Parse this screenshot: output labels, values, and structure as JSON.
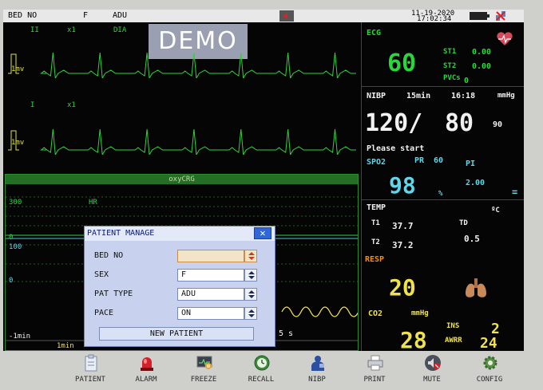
{
  "topbar": {
    "bed_label": "BED NO",
    "sex": "F",
    "pat_type": "ADU",
    "date": "11-19-2020",
    "time": "17:02:34"
  },
  "waves": {
    "lead1_name": "II",
    "lead1_gain": "x1",
    "lead1_filter": "DIA",
    "lead2_name": "I",
    "lead2_gain": "x1",
    "scale_label": "1mv",
    "demo_text": "DEMO"
  },
  "oxycrg": {
    "title": "oxyCRG",
    "hr_top": "300",
    "hr_label": "HR",
    "hr_zero": "0",
    "spo2_top": "100",
    "spo2_zero": "0",
    "time_left": "-1min",
    "time_marker": "1min",
    "time_right": "5 s"
  },
  "ecg": {
    "label": "ECG",
    "hr": "60",
    "st1_label": "ST1",
    "st1_value": "0.00",
    "st2_label": "ST2",
    "st2_value": "0.00",
    "pvcs_label": "PVCs",
    "pvcs_value": "0"
  },
  "nibp": {
    "label": "NIBP",
    "interval": "15min",
    "time": "16:18",
    "unit": "mmHg",
    "systolic": "120/",
    "diastolic": "80",
    "mean": "90",
    "status": "Please start"
  },
  "spo2": {
    "label": "SPO2",
    "pr_label": "PR",
    "pr_value": "60",
    "pi_label": "PI",
    "value": "98",
    "unit": "%",
    "pi_value": "2.00",
    "bar_glyph": "="
  },
  "temp": {
    "label": "TEMP",
    "unit": "ºC",
    "t1_label": "T1",
    "t1_value": "37.7",
    "td_label": "TD",
    "td_value": "0.5",
    "t2_label": "T2",
    "t2_value": "37.2"
  },
  "resp": {
    "label": "RESP",
    "value": "20"
  },
  "co2": {
    "label": "CO2",
    "unit": "mmHg",
    "value": "28",
    "ins_label": "INS",
    "ins_value": "2",
    "awrr_label": "AWRR",
    "awrr_value": "24"
  },
  "dialog": {
    "title": "PATIENT MANAGE",
    "bed_label": "BED NO",
    "bed_value": "",
    "sex_label": "SEX",
    "sex_value": "F",
    "pat_type_label": "PAT TYPE",
    "pat_type_value": "ADU",
    "pace_label": "PACE",
    "pace_value": "ON",
    "new_patient_label": "NEW PATIENT",
    "close_glyph": "✕"
  },
  "toolbar": {
    "patient": "PATIENT",
    "alarm": "ALARM",
    "freeze": "FREEZE",
    "recall": "RECALL",
    "nibp": "NIBP",
    "print": "PRINT",
    "mute": "MUTE",
    "config": "CONFIG"
  },
  "colors": {
    "ecg_green": "#27d83b",
    "spo2_cyan": "#5fd6ea",
    "resp_yellow": "#f0e24a",
    "co2_yellow": "#f0e24a",
    "resp_label_orange": "#f58a1d",
    "dialog_blue": "#c8d2ee"
  }
}
